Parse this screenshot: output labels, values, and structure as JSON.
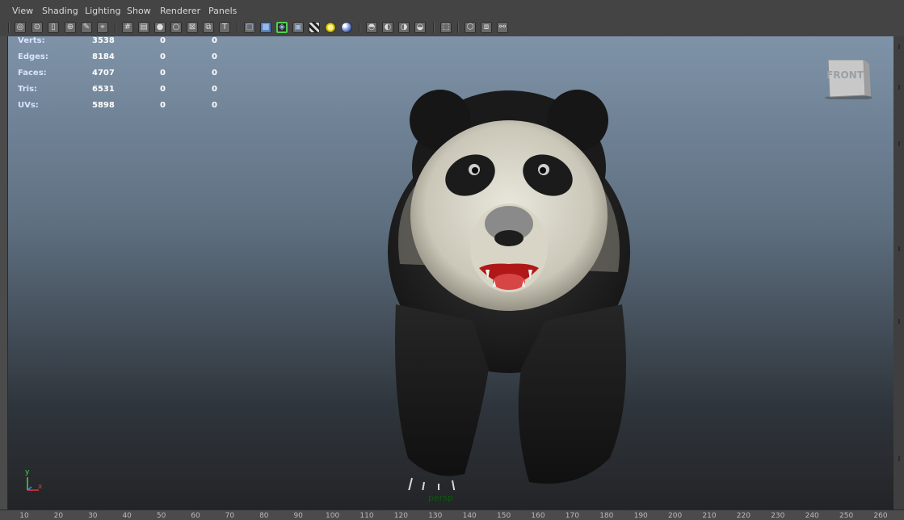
{
  "menu": [
    "View",
    "Shading",
    "Lighting",
    "Show",
    "Renderer",
    "Panels"
  ],
  "toolbar_icons": [
    "camera-attributes-icon",
    "bookmark-icon",
    "image-plane-icon",
    "2d-pan-zoom-icon",
    "grease-pencil-icon",
    "select-camera-icon",
    "grid-icon",
    "film-gate-icon",
    "resolution-gate-icon",
    "gate-mask-icon",
    "field-chart-icon",
    "safe-action-icon",
    "safe-title-icon",
    "wireframe-icon",
    "smooth-shade-icon",
    "wireframe-on-shaded-icon",
    "bounding-box-icon",
    "textured-icon",
    "use-all-lights-icon",
    "shadows-icon",
    "screen-space-ambient-occlusion-icon",
    "motion-blur-icon",
    "multisample-aa-icon",
    "depth-of-field-icon",
    "isolate-select-icon",
    "xray-icon",
    "xray-active-components-icon",
    "xray-joints-icon"
  ],
  "stats": [
    {
      "label": "Verts:",
      "values": [
        "3538",
        "0",
        "0"
      ]
    },
    {
      "label": "Edges:",
      "values": [
        "8184",
        "0",
        "0"
      ]
    },
    {
      "label": "Faces:",
      "values": [
        "4707",
        "0",
        "0"
      ]
    },
    {
      "label": "Tris:",
      "values": [
        "6531",
        "0",
        "0"
      ]
    },
    {
      "label": "UVs:",
      "values": [
        "5898",
        "0",
        "0"
      ]
    }
  ],
  "view_cube_label": "FRONT",
  "camera_name": "persp",
  "axis": {
    "y": "y",
    "x": "x"
  },
  "ruler": [
    "10",
    "20",
    "30",
    "40",
    "50",
    "60",
    "70",
    "80",
    "90",
    "100",
    "110",
    "120",
    "130",
    "140",
    "150",
    "160",
    "170",
    "180",
    "190",
    "200",
    "210",
    "220",
    "230",
    "240",
    "250",
    "260"
  ],
  "colors": {
    "selected_tool": "#4fd14f",
    "camera_label": "#0b5a0b",
    "axis_y": "#43d943",
    "axis_x": "#e03a3a",
    "axis_z": "#4b7bff"
  }
}
